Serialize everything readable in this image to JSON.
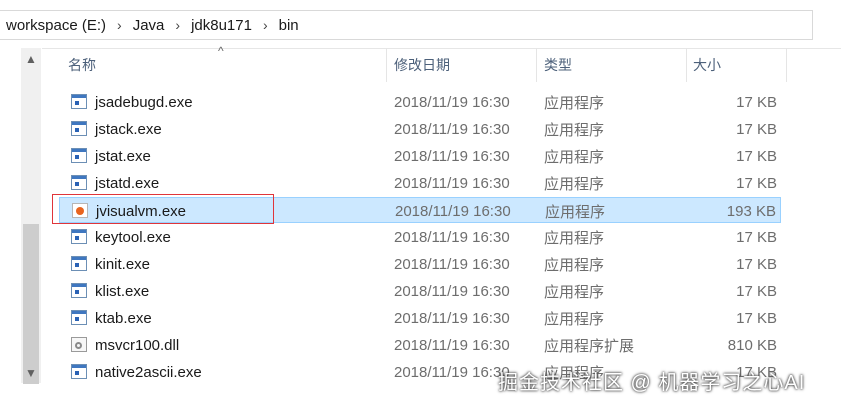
{
  "address": {
    "crumbs": [
      "workspace (E:)",
      "Java",
      "jdk8u171",
      "bin"
    ],
    "separator": "›"
  },
  "columns": {
    "name": "名称",
    "modified": "修改日期",
    "type": "类型",
    "size": "大小"
  },
  "files": [
    {
      "name": "jsadebugd.exe",
      "modified": "2018/11/19 16:30",
      "type": "应用程序",
      "size": "17 KB",
      "icon": "exe-icon"
    },
    {
      "name": "jstack.exe",
      "modified": "2018/11/19 16:30",
      "type": "应用程序",
      "size": "17 KB",
      "icon": "exe-icon"
    },
    {
      "name": "jstat.exe",
      "modified": "2018/11/19 16:30",
      "type": "应用程序",
      "size": "17 KB",
      "icon": "exe-icon"
    },
    {
      "name": "jstatd.exe",
      "modified": "2018/11/19 16:30",
      "type": "应用程序",
      "size": "17 KB",
      "icon": "exe-icon"
    },
    {
      "name": "jvisualvm.exe",
      "modified": "2018/11/19 16:30",
      "type": "应用程序",
      "size": "193 KB",
      "icon": "jvisualvm-icon",
      "selected": true
    },
    {
      "name": "keytool.exe",
      "modified": "2018/11/19 16:30",
      "type": "应用程序",
      "size": "17 KB",
      "icon": "exe-icon"
    },
    {
      "name": "kinit.exe",
      "modified": "2018/11/19 16:30",
      "type": "应用程序",
      "size": "17 KB",
      "icon": "exe-icon"
    },
    {
      "name": "klist.exe",
      "modified": "2018/11/19 16:30",
      "type": "应用程序",
      "size": "17 KB",
      "icon": "exe-icon"
    },
    {
      "name": "ktab.exe",
      "modified": "2018/11/19 16:30",
      "type": "应用程序",
      "size": "17 KB",
      "icon": "exe-icon"
    },
    {
      "name": "msvcr100.dll",
      "modified": "2018/11/19 16:30",
      "type": "应用程序扩展",
      "size": "810 KB",
      "icon": "dll-icon"
    },
    {
      "name": "native2ascii.exe",
      "modified": "2018/11/19 16:30",
      "type": "应用程序",
      "size": "17 KB",
      "icon": "exe-icon"
    }
  ],
  "watermark": "掘金技术社区 @ 机器学习之心AI",
  "colors": {
    "selection": "#cce8ff",
    "highlight_border": "#e0353a",
    "header_text": "#4c607a"
  }
}
